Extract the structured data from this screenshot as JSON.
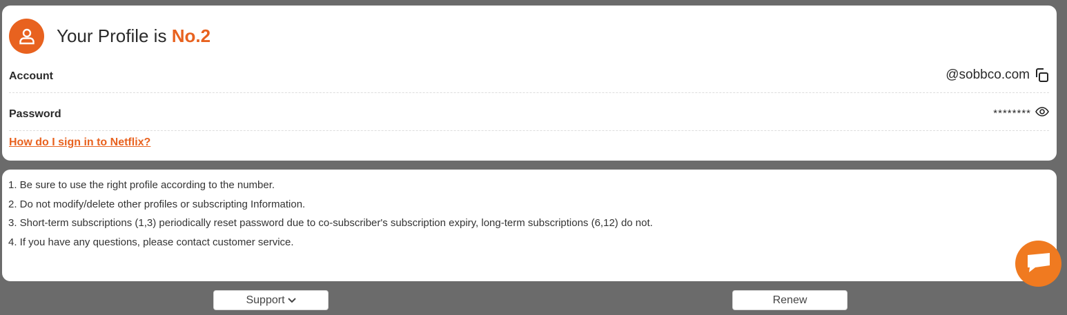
{
  "profile": {
    "title_prefix": "Your Profile is",
    "number": "No.2",
    "icon": "user-icon",
    "account_label": "Account",
    "account_value": "@sobbco.com",
    "password_label": "Password",
    "password_value": "********",
    "help_link": "How do I sign in to Netflix?"
  },
  "notes": [
    "1. Be sure to use the right profile according to the number.",
    "2. Do not modify/delete other profiles or subscripting Information.",
    "3. Short-term subscriptions (1,3) periodically reset password due to co-subscriber's subscription expiry, long-term subscriptions (6,12) do not.",
    "4. If you have any questions, please contact customer service."
  ],
  "buttons": {
    "support": "Support",
    "renew": "Renew"
  },
  "colors": {
    "accent": "#e8621f",
    "chat": "#f07a20",
    "background": "#6b6b6b"
  },
  "icons": {
    "copy": "copy-icon",
    "eye": "eye-icon",
    "chat": "chat-icon",
    "chevron": "chevron-down-icon"
  }
}
